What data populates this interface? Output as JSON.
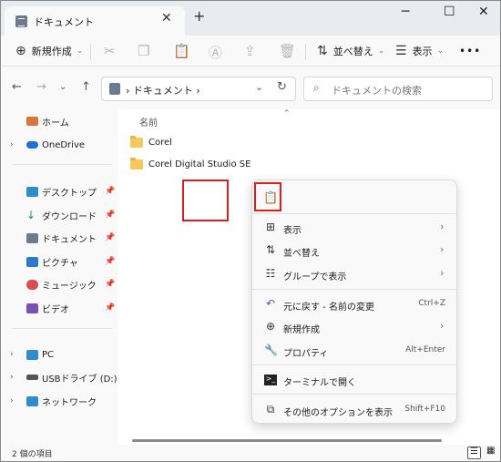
{
  "window": {
    "tab_title": "ドキュメント",
    "tab_close": "✕",
    "new_tab": "+",
    "minimize": "─",
    "maximize": "☐",
    "close": "✕"
  },
  "toolbar": {
    "new_label": "新規作成",
    "sort_label": "並べ替え",
    "view_label": "表示",
    "more_label": "•••"
  },
  "address": {
    "location": "ドキュメント",
    "breadcrumb_sep": "›",
    "search_placeholder": "ドキュメントの検索"
  },
  "sidebar": {
    "items": [
      {
        "label": "ホーム",
        "icon": "home-icon"
      },
      {
        "label": "OneDrive",
        "icon": "cloud-icon"
      },
      {
        "label": "デスクトップ",
        "icon": "desktop-icon"
      },
      {
        "label": "ダウンロード",
        "icon": "download-icon"
      },
      {
        "label": "ドキュメント",
        "icon": "document-icon"
      },
      {
        "label": "ピクチャ",
        "icon": "picture-icon"
      },
      {
        "label": "ミュージック",
        "icon": "music-icon"
      },
      {
        "label": "ビデオ",
        "icon": "video-icon"
      },
      {
        "label": "PC",
        "icon": "pc-icon"
      },
      {
        "label": "USBドライブ (D:)",
        "icon": "usb-drive-icon"
      },
      {
        "label": "ネットワーク",
        "icon": "network-icon"
      }
    ]
  },
  "content": {
    "column_name": "名前",
    "files": [
      {
        "name": "Corel"
      },
      {
        "name": "Corel Digital Studio SE"
      }
    ]
  },
  "context_menu": {
    "items": [
      {
        "label": "表示",
        "icon": "view-grid-icon",
        "shortcut": ""
      },
      {
        "label": "並べ替え",
        "icon": "sort-icon",
        "shortcut": ""
      },
      {
        "label": "グループで表示",
        "icon": "group-icon",
        "shortcut": ""
      },
      {
        "label": "元に戻す - 名前の変更",
        "icon": "undo-icon",
        "shortcut": "Ctrl+Z"
      },
      {
        "label": "新規作成",
        "icon": "new-icon",
        "shortcut": ""
      },
      {
        "label": "プロパティ",
        "icon": "properties-icon",
        "shortcut": "Alt+Enter"
      },
      {
        "label": "ターミナルで開く",
        "icon": "terminal-icon",
        "shortcut": ""
      },
      {
        "label": "その他のオプションを表示",
        "icon": "more-options-icon",
        "shortcut": "Shift+F10"
      }
    ]
  },
  "status": {
    "item_count": "2 個の項目"
  },
  "colors": {
    "highlight_red": "#e01e1e",
    "accent_blue": "#0067c0",
    "folder_yellow": "#f7c85a"
  }
}
